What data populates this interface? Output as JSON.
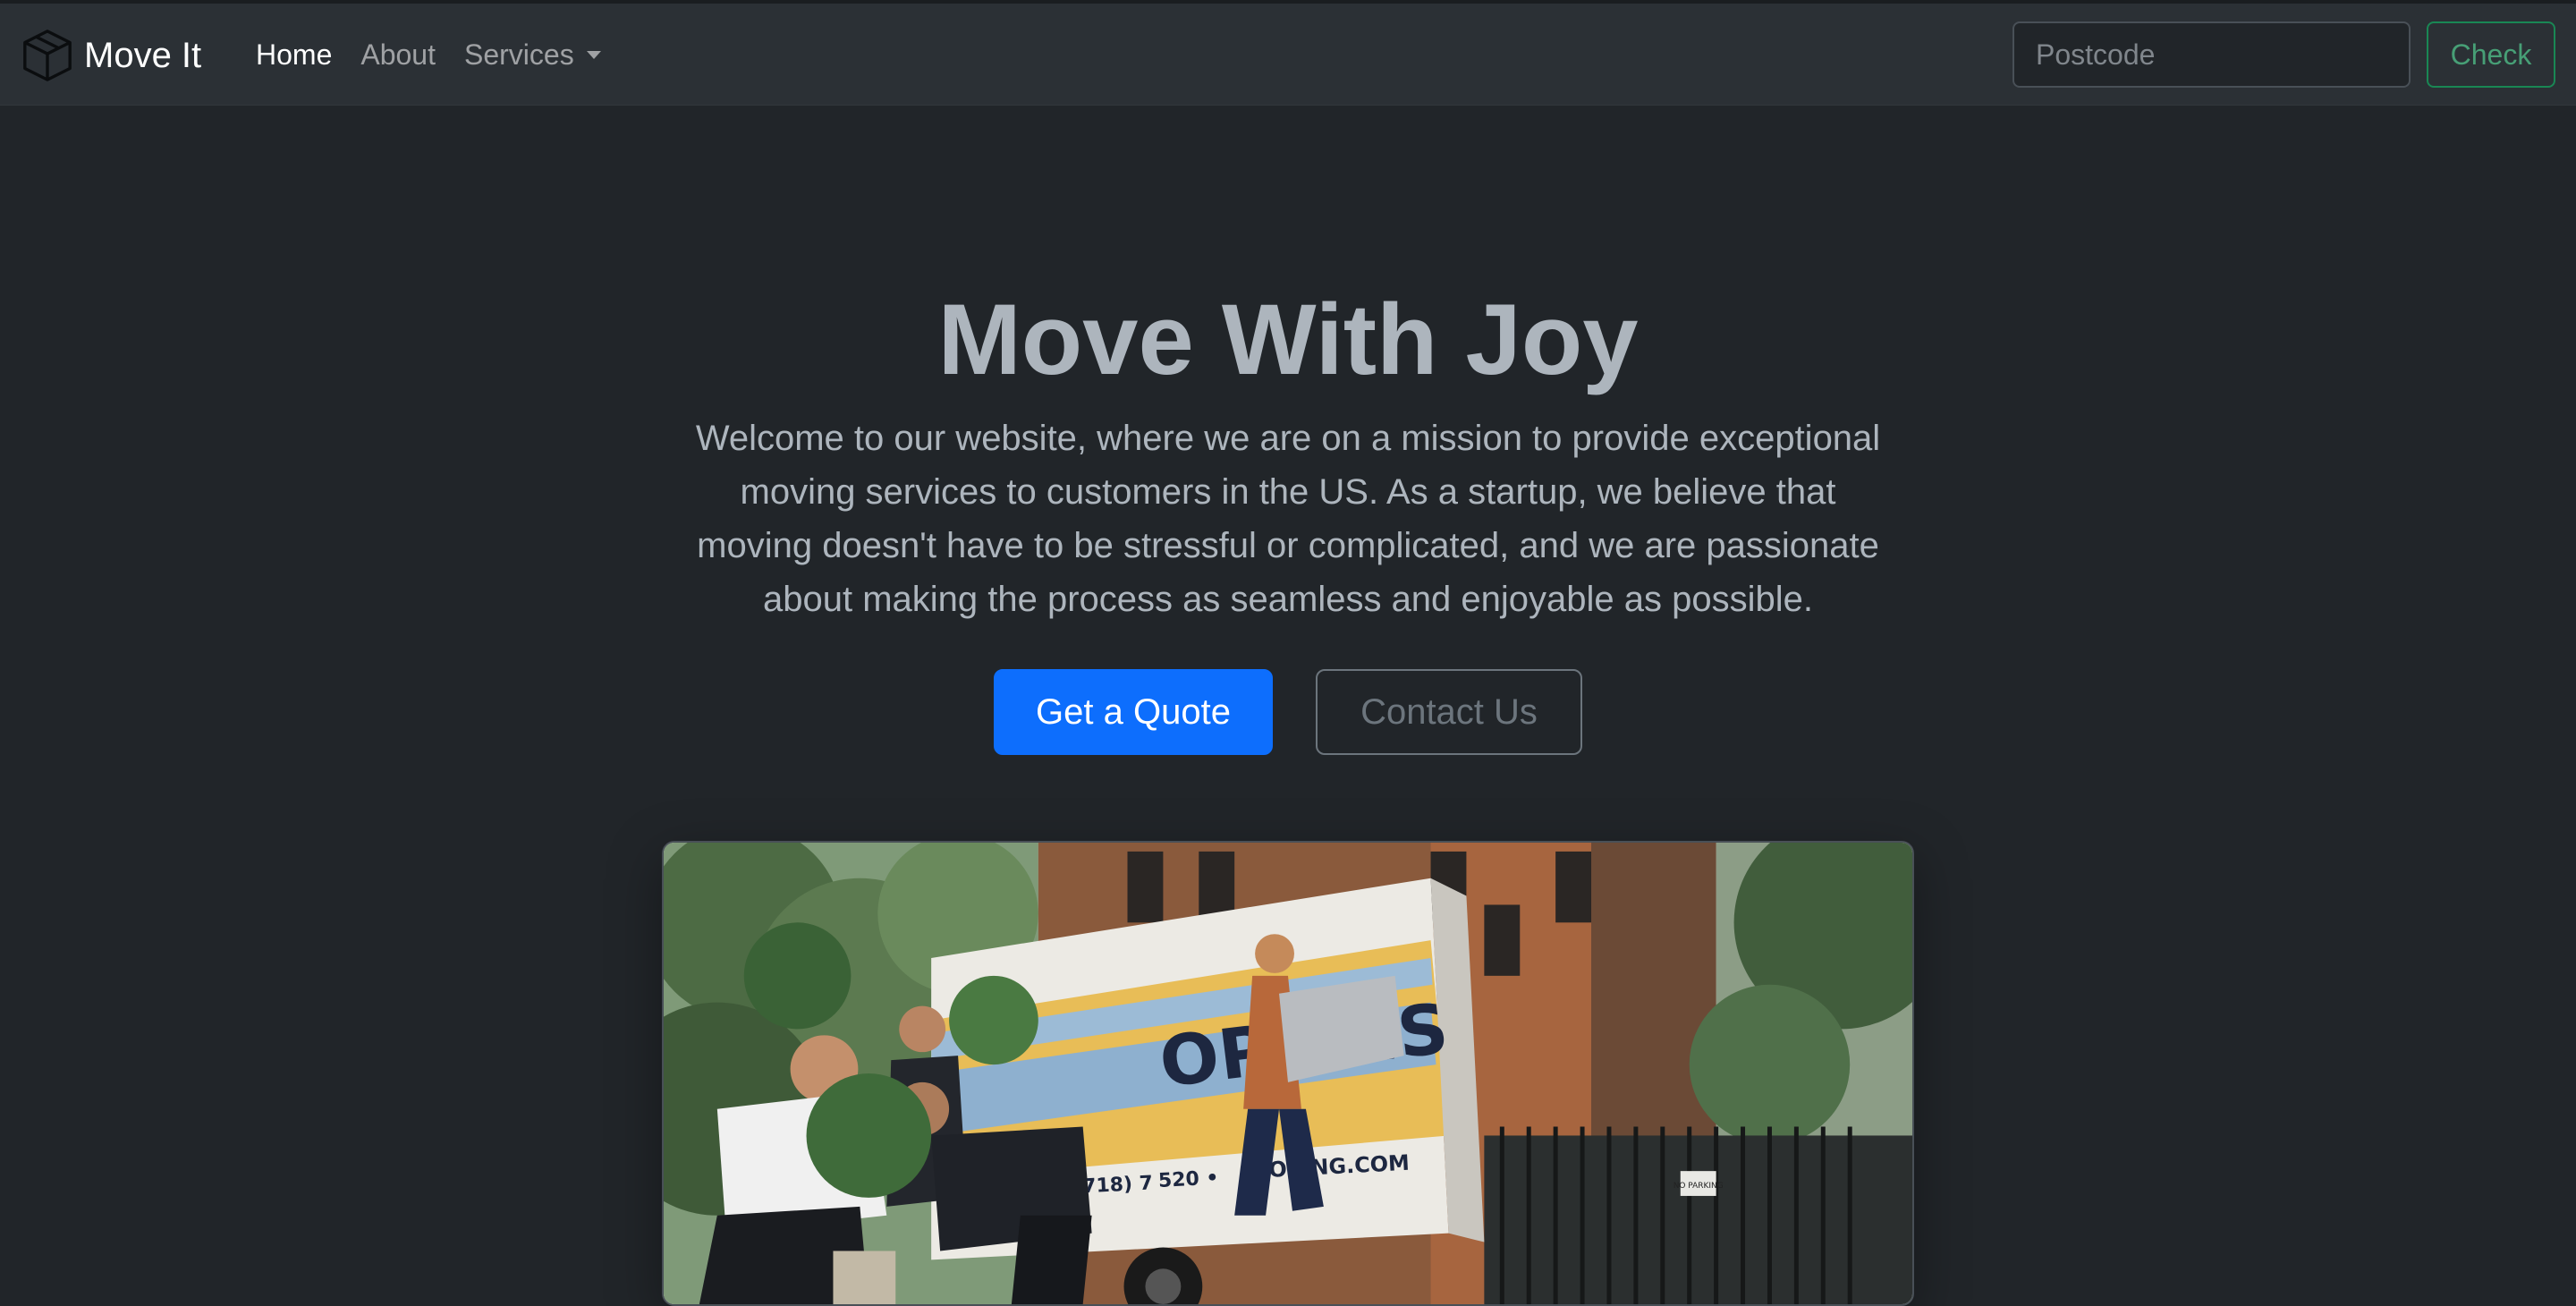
{
  "brand": {
    "icon": "box-icon",
    "name": "Move It"
  },
  "nav": {
    "items": [
      {
        "label": "Home",
        "active": true
      },
      {
        "label": "About",
        "active": false
      },
      {
        "label": "Services",
        "active": false,
        "dropdown": true
      }
    ]
  },
  "search": {
    "placeholder": "Postcode",
    "value": "",
    "button_label": "Check"
  },
  "hero": {
    "title": "Move With Joy",
    "lead": "Welcome to our website, where we are on a mission to provide exceptional moving services to customers in the US. As a startup, we believe that moving doesn't have to be stressful or complicated, and we are passionate about making the process as seamless and enjoyable as possible.",
    "primary_button": "Get a Quote",
    "secondary_button": "Contact Us",
    "image": {
      "truck_text_1": "OPOLIS",
      "truck_text_2": "MOVING.COM",
      "truck_text_3": "(718) 7",
      "truck_text_4": "520 •",
      "sign_text": "NO PARKING"
    }
  },
  "colors": {
    "background": "#212529",
    "navbar": "#2b3035",
    "primary": "#0d6efd",
    "success": "#198754",
    "secondary": "#6c757d"
  }
}
